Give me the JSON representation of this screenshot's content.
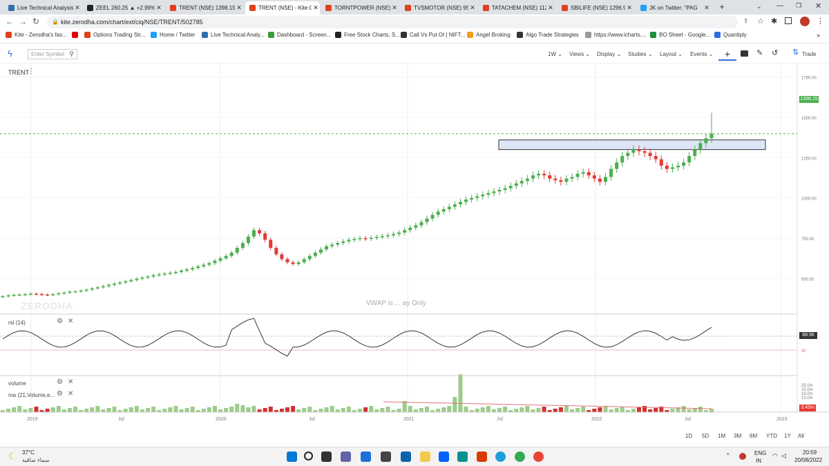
{
  "browser": {
    "tabs": [
      {
        "label": "Live Technical Analysis",
        "color": "#2f6fb0",
        "active": false
      },
      {
        "label": "ZEEL 260.25 ▲ +2.99%",
        "color": "#222222",
        "active": false
      },
      {
        "label": "TRENT (NSE) 1398.15",
        "color": "#e0401c",
        "active": false
      },
      {
        "label": "TRENT (NSE) - Kite Ch",
        "color": "#e0401c",
        "active": true
      },
      {
        "label": "TORNTPOWER (NSE) 95",
        "color": "#e0401c",
        "active": false
      },
      {
        "label": "TVSMOTOR (NSE) 956",
        "color": "#e0401c",
        "active": false
      },
      {
        "label": "TATACHEM (NSE) 112",
        "color": "#e0401c",
        "active": false
      },
      {
        "label": "SBILIFE (NSE) 1296.95",
        "color": "#e0401c",
        "active": false
      },
      {
        "label": "JK on Twitter: \"PAG",
        "color": "#1da1f2",
        "active": false
      }
    ],
    "url": "kite.zerodha.com/chart/ext/ciq/NSE/TRENT/502785",
    "bookmarks": [
      {
        "label": "Kite - Zerodha's fas...",
        "color": "#e0401c"
      },
      {
        "label": "",
        "color": "#e00000"
      },
      {
        "label": "Options Trading Str...",
        "color": "#e0401c"
      },
      {
        "label": "Home / Twitter",
        "color": "#1da1f2"
      },
      {
        "label": "Live Technical Analy...",
        "color": "#2f6fb0"
      },
      {
        "label": "Dashboard - Screen...",
        "color": "#3c9a3c"
      },
      {
        "label": "Free Stock Charts, S...",
        "color": "#222222"
      },
      {
        "label": "Call Vs Put OI | NIFT...",
        "color": "#333333"
      },
      {
        "label": "Angel Broking",
        "color": "#f0a020"
      },
      {
        "label": "Algo Trade Strategies",
        "color": "#333333"
      },
      {
        "label": "https://www.icharts....",
        "color": "#999999"
      },
      {
        "label": "BO Sheet - Google...",
        "color": "#1e8e3e"
      },
      {
        "label": "Quantiply",
        "color": "#2d6cdf"
      }
    ]
  },
  "toolbar": {
    "symbol_placeholder": "Enter Symbol",
    "interval": "1W",
    "views": "Views",
    "display": "Display",
    "studies": "Studies",
    "layout": "Layout",
    "events": "Events",
    "trade": "Trade"
  },
  "chart": {
    "symbol": "TRENT",
    "watermark": "ZERODHA",
    "vwap_note": "VWAP is ... ay Only",
    "rsi_label": "rsi (14)",
    "volume_label": "volume",
    "ma_label": "ma (21,Volume,e...",
    "current_price": "1398.15",
    "rsi_value": "68.96",
    "volume_value": "3.45m",
    "colors": {
      "up": "#4caf50",
      "down": "#e53935",
      "price_line": "#4caf50",
      "zone": "#dce6f7"
    }
  },
  "chart_data": {
    "type": "candlestick",
    "title": "TRENT",
    "price_axis": [
      "1750.00",
      "1500.00",
      "1250.00",
      "1000.00",
      "750.00",
      "500.00"
    ],
    "x_axis": [
      "2019",
      "Jul",
      "2020",
      "Jul",
      "2021",
      "Jul",
      "2022",
      "Jul",
      "2023"
    ],
    "rsi_axis": [
      "60",
      "40"
    ],
    "volume_axis": [
      "25.0m",
      "20.0m",
      "15.0m",
      "10.0m"
    ],
    "weekly_close": [
      390,
      395,
      398,
      400,
      402,
      405,
      403,
      400,
      398,
      402,
      408,
      412,
      418,
      420,
      425,
      430,
      438,
      445,
      452,
      460,
      468,
      475,
      482,
      490,
      498,
      505,
      512,
      520,
      525,
      530,
      535,
      540,
      548,
      556,
      565,
      575,
      585,
      595,
      610,
      625,
      640,
      660,
      690,
      720,
      760,
      800,
      780,
      740,
      690,
      650,
      620,
      600,
      590,
      600,
      620,
      640,
      660,
      680,
      700,
      710,
      720,
      730,
      740,
      745,
      750,
      748,
      752,
      758,
      762,
      768,
      776,
      785,
      800,
      815,
      830,
      850,
      872,
      895,
      915,
      930,
      945,
      960,
      975,
      990,
      1000,
      1010,
      1020,
      1030,
      1040,
      1050,
      1060,
      1075,
      1090,
      1105,
      1120,
      1140,
      1150,
      1140,
      1120,
      1110,
      1100,
      1120,
      1130,
      1150,
      1160,
      1140,
      1120,
      1100,
      1130,
      1180,
      1220,
      1260,
      1280,
      1300,
      1290,
      1280,
      1260,
      1240,
      1200,
      1180,
      1190,
      1200,
      1220,
      1260,
      1300,
      1340,
      1370,
      1398
    ],
    "range_buttons": [
      "1D",
      "5D",
      "1M",
      "3M",
      "6M",
      "YTD",
      "1Y",
      "All"
    ]
  },
  "taskbar": {
    "weather_temp": "37°C",
    "weather_desc": "سماء صافية",
    "lang": "ENG",
    "lang2": "IN",
    "time": "20:59",
    "date": "20/08/2022"
  }
}
